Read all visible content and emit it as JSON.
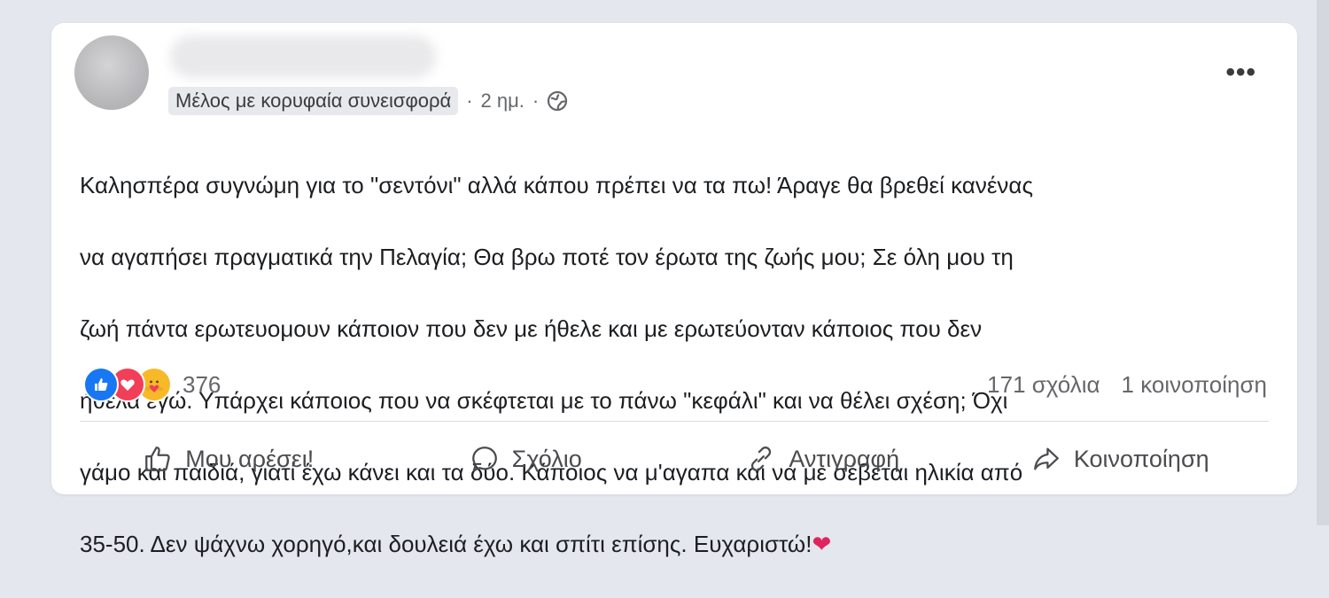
{
  "post": {
    "badge": "Μέλος με κορυφαία συνεισφορά",
    "time": "2 ημ.",
    "dot": "·",
    "more": "•••",
    "text_lines": [
      "Καλησπέρα συγνώμη για το \"σεντόνι\" αλλά κάπου πρέπει να τα πω! Άραγε θα βρεθεί κανένας",
      "να αγαπήσει πραγματικά την Πελαγία; Θα βρω ποτέ τον έρωτα της ζωής μου; Σε όλη μου τη",
      "ζωή πάντα ερωτευομουν κάποιον που δεν με ήθελε και με ερωτεύονταν κάποιος που δεν",
      "ήθελα εγώ. Υπάρχει κάποιος που να σκέφτεται με το πάνω \"κεφάλι\" και να θέλει σχέση; Όχι",
      "γάμο και παιδιά, γιατί έχω κάνει και τα δύο. Κάποιος να μ'αγαπα και να με σέβεται ηλικία από",
      "35-50. Δεν ψάχνω χορηγό,και δουλειά έχω και σπίτι επίσης. Ευχαριστώ!"
    ],
    "emoji": "❤"
  },
  "reactions": {
    "count": "376",
    "types": [
      "like-icon",
      "love-icon",
      "care-icon"
    ]
  },
  "stats": {
    "comments": "171 σχόλια",
    "shares": "1 κοινοποίηση"
  },
  "actions": {
    "like": "Μου αρέσει!",
    "comment": "Σχόλιο",
    "copy": "Αντιγραφή",
    "share": "Κοινοποίηση"
  },
  "colors": {
    "like_blue": "#1877f2",
    "love_red": "#f33e58",
    "care_yellow": "#f7b928",
    "meta_gray": "#65676b"
  }
}
